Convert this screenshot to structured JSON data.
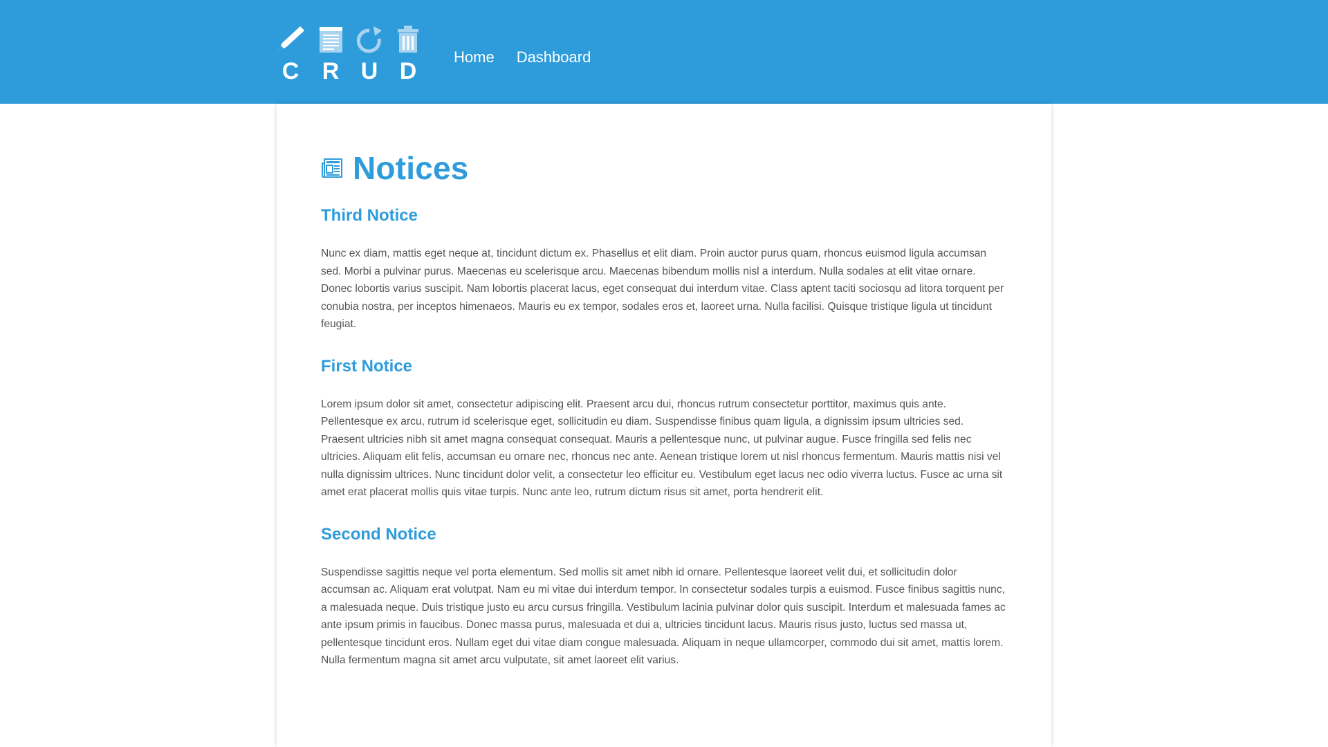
{
  "header": {
    "logo_letters": [
      "C",
      "R",
      "U",
      "D"
    ],
    "nav": [
      {
        "label": "Home"
      },
      {
        "label": "Dashboard"
      }
    ]
  },
  "main": {
    "title": "Notices",
    "notices": [
      {
        "title": "Third Notice",
        "body": "Nunc ex diam, mattis eget neque at, tincidunt dictum ex. Phasellus et elit diam. Proin auctor purus quam, rhoncus euismod ligula accumsan sed. Morbi a pulvinar purus. Maecenas eu scelerisque arcu. Maecenas bibendum mollis nisl a interdum. Nulla sodales at elit vitae ornare. Donec lobortis varius suscipit. Nam lobortis placerat lacus, eget consequat dui interdum vitae. Class aptent taciti sociosqu ad litora torquent per conubia nostra, per inceptos himenaeos. Mauris eu ex tempor, sodales eros et, laoreet urna. Nulla facilisi. Quisque tristique ligula ut tincidunt feugiat."
      },
      {
        "title": "First Notice",
        "body": "Lorem ipsum dolor sit amet, consectetur adipiscing elit. Praesent arcu dui, rhoncus rutrum consectetur porttitor, maximus quis ante. Pellentesque ex arcu, rutrum id scelerisque eget, sollicitudin eu diam. Suspendisse finibus quam ligula, a dignissim ipsum ultricies sed. Praesent ultricies nibh sit amet magna consequat consequat. Mauris a pellentesque nunc, ut pulvinar augue. Fusce fringilla sed felis nec ultricies. Aliquam elit felis, accumsan eu ornare nec, rhoncus nec ante. Aenean tristique lorem ut nisl rhoncus fermentum. Mauris mattis nisi vel nulla dignissim ultrices. Nunc tincidunt dolor velit, a consectetur leo efficitur eu. Vestibulum eget lacus nec odio viverra luctus. Fusce ac urna sit amet erat placerat mollis quis vitae turpis. Nunc ante leo, rutrum dictum risus sit amet, porta hendrerit elit."
      },
      {
        "title": "Second Notice",
        "body": "Suspendisse sagittis neque vel porta elementum. Sed mollis sit amet nibh id ornare. Pellentesque laoreet velit dui, et sollicitudin dolor accumsan ac. Aliquam erat volutpat. Nam eu mi vitae dui interdum tempor. In consectetur sodales turpis a euismod. Fusce finibus sagittis nunc, a malesuada neque. Duis tristique justo eu arcu cursus fringilla. Vestibulum lacinia pulvinar dolor quis suscipit. Interdum et malesuada fames ac ante ipsum primis in faucibus. Donec massa purus, malesuada et dui a, ultricies tincidunt lacus. Mauris risus justo, luctus sed massa ut, pellentesque tincidunt eros. Nullam eget dui vitae diam congue malesuada. Aliquam in neque ullamcorper, commodo dui sit amet, mattis lorem. Nulla fermentum magna sit amet arcu vulputate, sit amet laoreet elit varius."
      }
    ]
  },
  "icons": {
    "logo_icons": [
      "pencil-icon",
      "notepad-icon",
      "refresh-icon",
      "trash-icon"
    ],
    "title_icon": "newspaper-icon"
  },
  "colors": {
    "brand": "#2e9cdb",
    "body_text": "#555555",
    "logo_icon_light": "#a9d4f0"
  }
}
